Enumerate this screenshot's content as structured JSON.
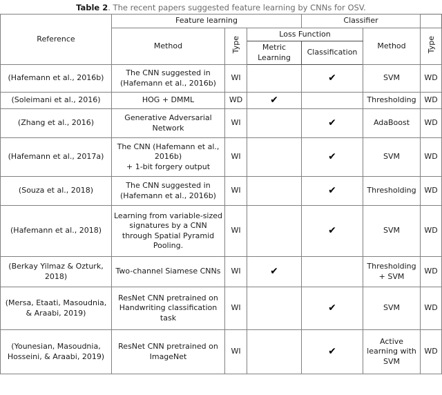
{
  "caption": {
    "label": "Table 2",
    "text": ". The recent papers suggested feature learning by CNNs for OSV."
  },
  "table": {
    "header": {
      "reference": "Reference",
      "feature_learning": "Feature learning",
      "classifier": "Classifier",
      "fl_method": "Method",
      "fl_type": "Type",
      "loss_function": "Loss Function",
      "metric_learning": "Metric Learning",
      "classification": "Classification",
      "cl_method": "Method",
      "cl_type": "Type"
    },
    "check_glyph": "✔",
    "rows": [
      {
        "reference": "(Hafemann et al., 2016b)",
        "fl_method": "The CNN suggested in (Hafemann et al., 2016b)",
        "fl_type": "WI",
        "metric_learning": "",
        "classification": "✔",
        "cl_method": "SVM",
        "cl_type": "WD"
      },
      {
        "reference": "(Soleimani et al., 2016)",
        "fl_method": "HOG + DMML",
        "fl_type": "WD",
        "metric_learning": "✔",
        "classification": "",
        "cl_method": "Thresholding",
        "cl_type": "WD"
      },
      {
        "reference": "(Zhang et al., 2016)",
        "fl_method": "Generative Adversarial Network",
        "fl_type": "WI",
        "metric_learning": "",
        "classification": "✔",
        "cl_method": "AdaBoost",
        "cl_type": "WD"
      },
      {
        "reference": "(Hafemann et al., 2017a)",
        "fl_method": "The CNN (Hafemann et al., 2016b)\n+ 1-bit forgery output",
        "fl_type": "WI",
        "metric_learning": "",
        "classification": "✔",
        "cl_method": "SVM",
        "cl_type": "WD"
      },
      {
        "reference": "(Souza et al., 2018)",
        "fl_method": "The CNN suggested in (Hafemann et al., 2016b)",
        "fl_type": "WI",
        "metric_learning": "",
        "classification": "✔",
        "cl_method": "Thresholding",
        "cl_type": "WD"
      },
      {
        "reference": "(Hafemann et al., 2018)",
        "fl_method": "Learning from variable-sized signatures by a CNN through Spatial Pyramid Pooling.",
        "fl_type": "WI",
        "metric_learning": "",
        "classification": "✔",
        "cl_method": "SVM",
        "cl_type": "WD"
      },
      {
        "reference": "(Berkay Yilmaz & Ozturk, 2018)",
        "fl_method": "Two-channel Siamese CNNs",
        "fl_type": "WI",
        "metric_learning": "✔",
        "classification": "",
        "cl_method": "Thresholding + SVM",
        "cl_type": "WD"
      },
      {
        "reference": "(Mersa, Etaati, Masoudnia, & Araabi, 2019)",
        "fl_method": "ResNet CNN pretrained on Handwriting classification task",
        "fl_type": "WI",
        "metric_learning": "",
        "classification": "✔",
        "cl_method": "SVM",
        "cl_type": "WD"
      },
      {
        "reference": "(Younesian, Masoudnia, Hosseini, & Araabi, 2019)",
        "fl_method": "ResNet CNN pretrained on ImageNet",
        "fl_type": "WI",
        "metric_learning": "",
        "classification": "✔",
        "cl_method": "Active learning with SVM",
        "cl_type": "WD"
      }
    ]
  },
  "colors": {
    "border": "#808080",
    "border_strong": "#6e6e6e",
    "text": "#1a1a1a",
    "caption_text": "#6b6b6b"
  }
}
